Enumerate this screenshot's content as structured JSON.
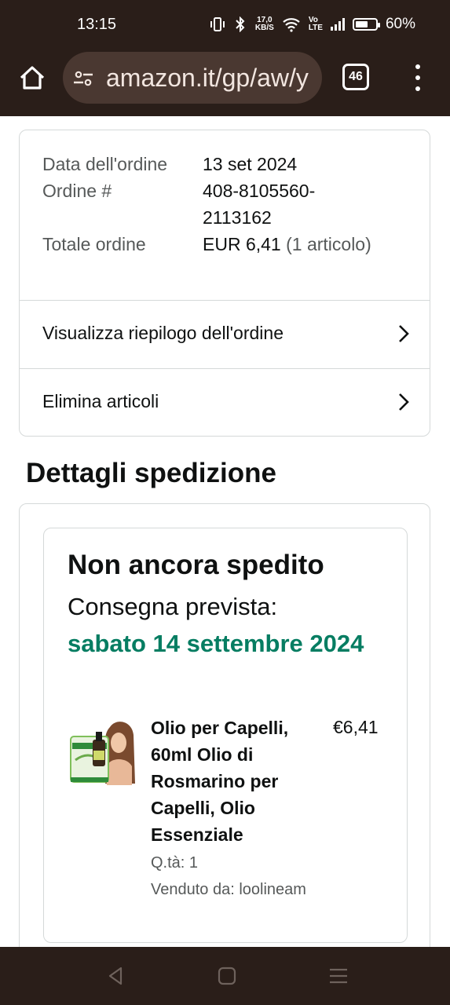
{
  "status_bar": {
    "time": "13:15",
    "speed_value": "17,0",
    "speed_unit": "KB/S",
    "volte_top": "Vo",
    "volte_bottom": "LTE",
    "battery": "60%",
    "battery_level": 0.6
  },
  "browser": {
    "url": "amazon.it/gp/aw/y",
    "tab_count": "46"
  },
  "order": {
    "date_label": "Data dell'ordine",
    "date_value": "13 set 2024",
    "number_label": "Ordine #",
    "number_value": "408-8105560-2113162",
    "total_label": "Totale ordine",
    "total_value": "EUR 6,41",
    "total_items": "(1 articolo)",
    "summary_link": "Visualizza riepilogo dell'ordine",
    "delete_link": "Elimina articoli"
  },
  "shipping": {
    "section_title": "Dettagli spedizione",
    "status": "Non ancora spedito",
    "delivery_label": "Consegna prevista:",
    "delivery_date": "sabato 14 settembre 2024",
    "item": {
      "title": "Olio per Capelli, 60ml Olio di Rosmarino per Capelli, Olio Essenziale",
      "price": "€6,41",
      "quantity": "Q.tà: 1",
      "seller": "Venduto da: loolineam"
    }
  },
  "colors": {
    "system_bar": "#2a1e19",
    "url_box": "#4a3831",
    "delivery_green": "#067d62",
    "border": "#d5d9d9"
  }
}
